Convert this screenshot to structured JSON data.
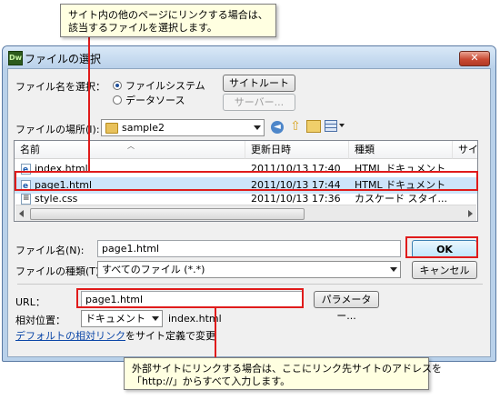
{
  "window": {
    "title": "ファイルの選択",
    "app_icon_text": "Dw",
    "close_glyph": "✕"
  },
  "select_from": {
    "label": "ファイル名を選択：",
    "options": [
      "ファイルシステム",
      "データソース"
    ],
    "selected": "ファイルシステム",
    "site_root_button": "サイトルート",
    "server_button": "サーバー..."
  },
  "location": {
    "label": "ファイルの場所(I):",
    "value": "sample2"
  },
  "file_list": {
    "columns": [
      "名前",
      "更新日時",
      "種類",
      "サイ"
    ],
    "rows": [
      {
        "name": "index.html",
        "modified": "2011/10/13 17:40",
        "type": "HTML ドキュメント"
      },
      {
        "name": "page1.html",
        "modified": "2011/10/13 17:44",
        "type": "HTML ドキュメント"
      },
      {
        "name": "style.css",
        "modified": "2011/10/13 17:36",
        "type": "カスケード スタイ..."
      }
    ],
    "selected_index": 1
  },
  "filename": {
    "label": "ファイル名(N):",
    "value": "page1.html"
  },
  "filetype": {
    "label": "ファイルの種類(T):",
    "value": "すべてのファイル (*.*)"
  },
  "buttons": {
    "ok": "OK",
    "cancel": "キャンセル",
    "parameters": "パラメーター..."
  },
  "url": {
    "label": "URL：",
    "value": "page1.html"
  },
  "relative": {
    "label": "相対位置：",
    "value": "ドキュメント",
    "target": "index.html"
  },
  "default_link": {
    "link_text": "デフォルトの相対リンク",
    "suffix": "をサイト定義で変更"
  },
  "callouts": {
    "top_line1": "サイト内の他のページにリンクする場合は、",
    "top_line2": "該当するファイルを選択します。",
    "bottom_line1": "外部サイトにリンクする場合は、ここにリンク先サイトのアドレスを",
    "bottom_line2": "「http://」からすべて入力します。"
  },
  "colors": {
    "annotation_red": "#e01b1b",
    "callout_bg": "#ffffe1",
    "selection_bg": "#cde4fa"
  }
}
